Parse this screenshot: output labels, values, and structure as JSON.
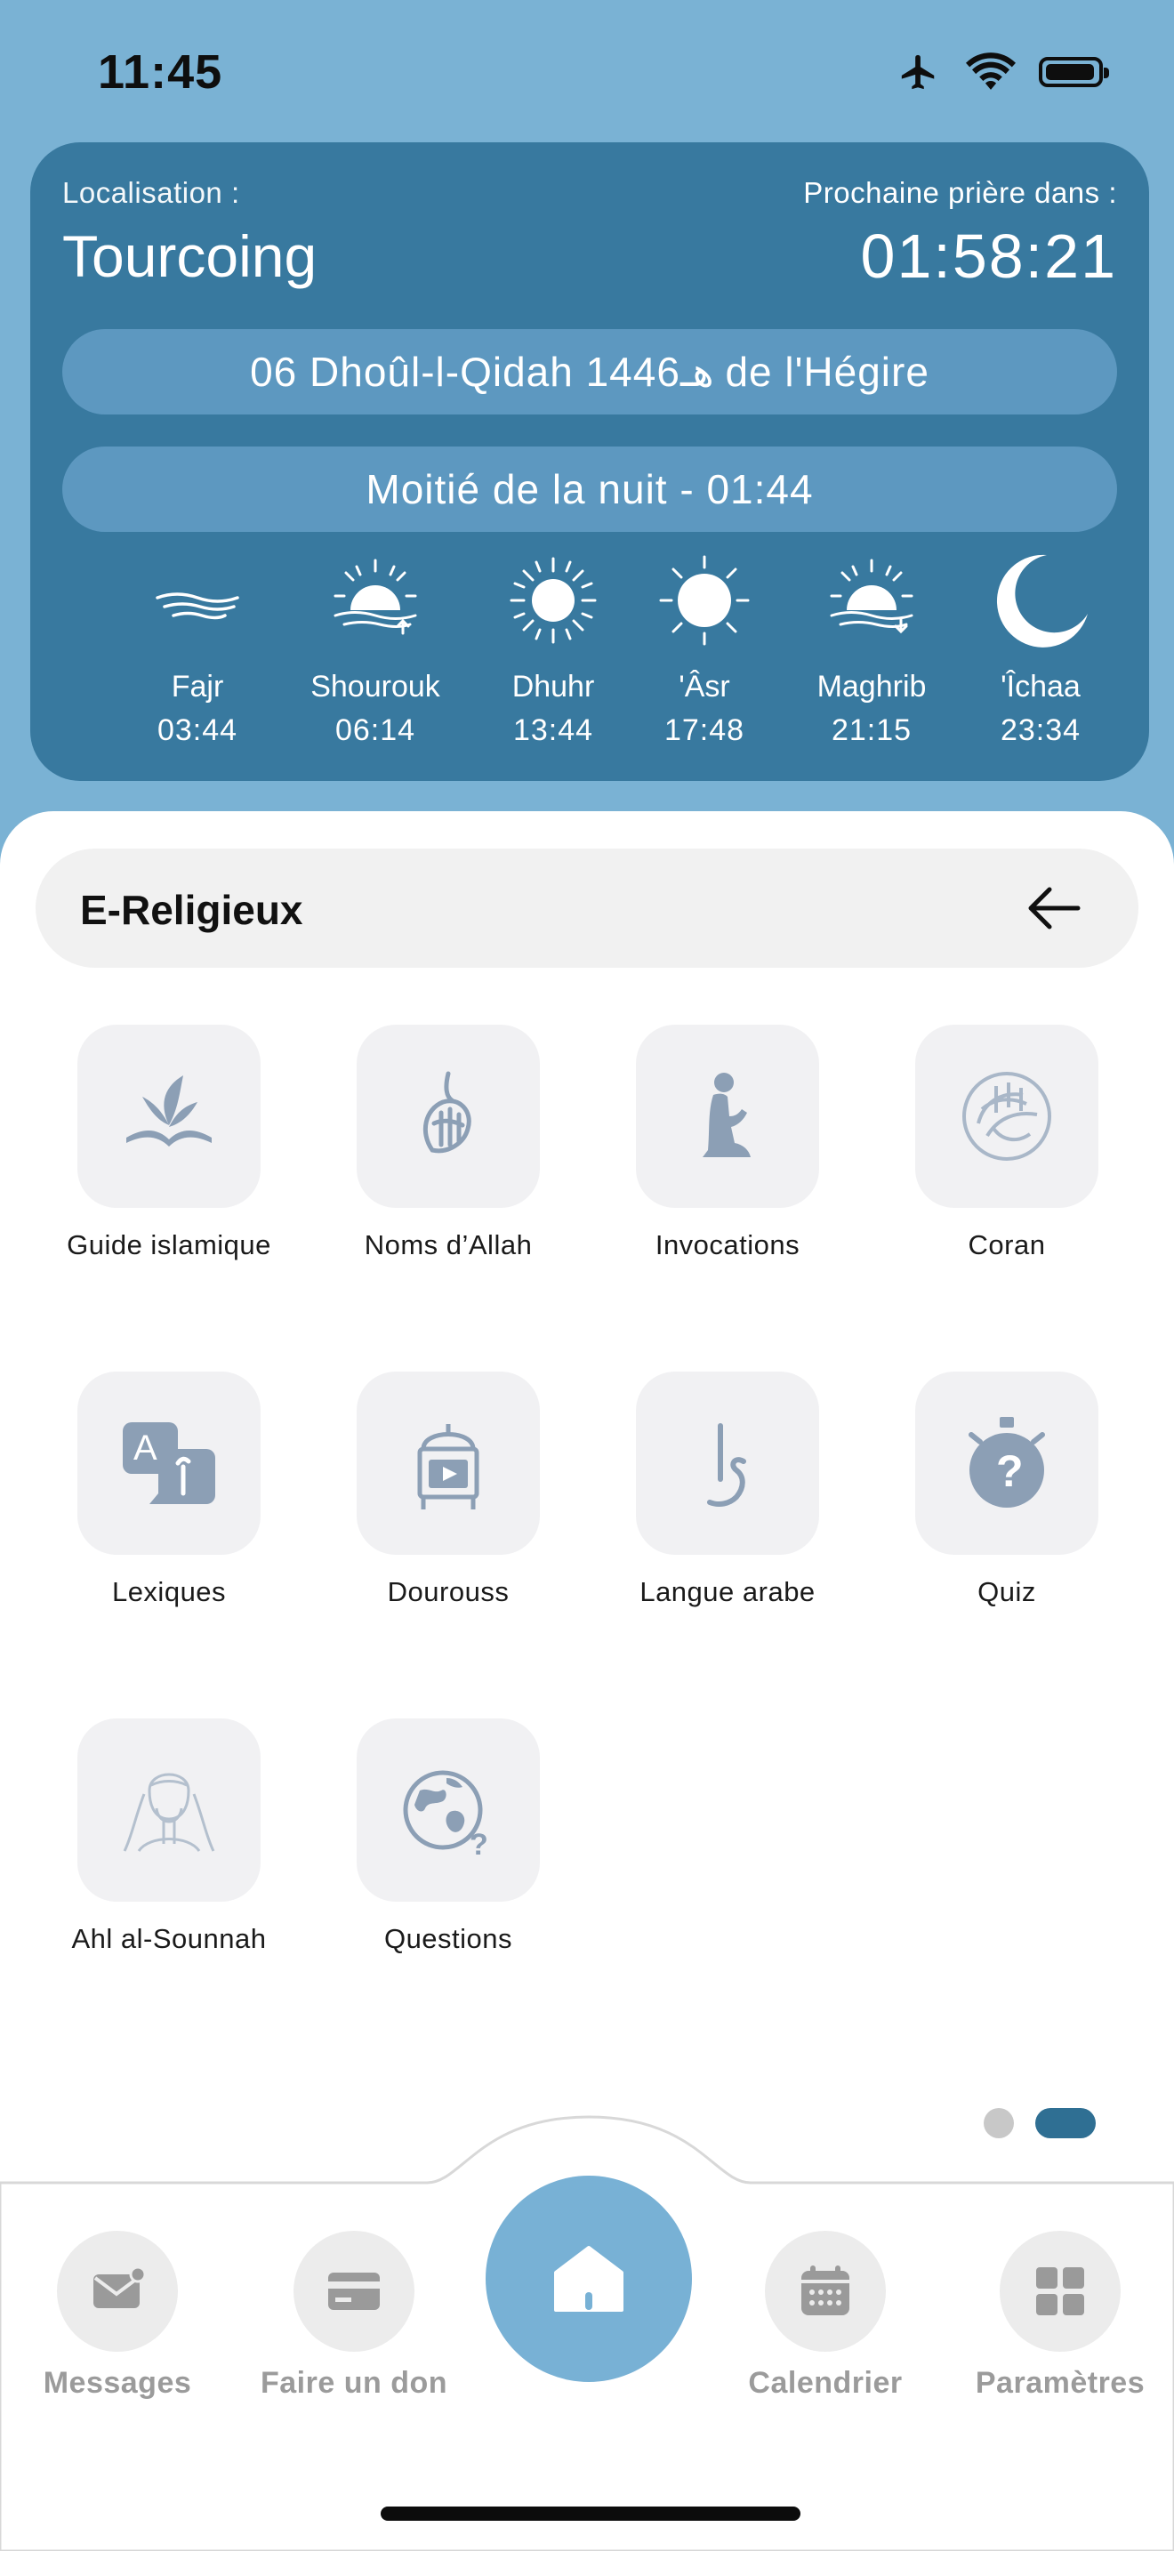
{
  "status_bar": {
    "time": "11:45",
    "icons": [
      "airplane-icon",
      "wifi-icon",
      "battery-icon"
    ]
  },
  "prayer_card": {
    "location_label": "Localisation :",
    "city": "Tourcoing",
    "next_prayer_label": "Prochaine prière dans :",
    "countdown": "01:58:21",
    "hijri_date": "06 Dhoûl-l-Qidah 1446هـ de l'Hégire",
    "midnight": "Moitié de la nuit - 01:44",
    "prayers": [
      {
        "name": "Fajr",
        "time": "03:44",
        "icon": "dawn-icon"
      },
      {
        "name": "Shourouk",
        "time": "06:14",
        "icon": "sunrise-icon"
      },
      {
        "name": "Dhuhr",
        "time": "13:44",
        "icon": "sun-icon"
      },
      {
        "name": "'Âsr",
        "time": "17:48",
        "icon": "sun-icon"
      },
      {
        "name": "Maghrib",
        "time": "21:15",
        "icon": "sunset-icon"
      },
      {
        "name": "'Îchaa",
        "time": "23:34",
        "icon": "moon-icon"
      }
    ]
  },
  "section": {
    "title": "E-Religieux",
    "items": [
      {
        "label": "Guide islamique",
        "icon": "book-icon"
      },
      {
        "label": "Noms d’Allah",
        "icon": "calligraphy-icon"
      },
      {
        "label": "Invocations",
        "icon": "praying-person-icon"
      },
      {
        "label": "Coran",
        "icon": "quran-seal-icon"
      },
      {
        "label": "Lexiques",
        "icon": "translate-icon"
      },
      {
        "label": "Dourouss",
        "icon": "lesson-video-icon"
      },
      {
        "label": "Langue arabe",
        "icon": "arabic-letter-icon"
      },
      {
        "label": "Quiz",
        "icon": "quiz-stopwatch-icon"
      },
      {
        "label": "Ahl al-Sounnah",
        "icon": "scholar-icon"
      },
      {
        "label": "Questions",
        "icon": "globe-question-icon"
      }
    ],
    "pages": {
      "count": 2,
      "active": 2
    }
  },
  "bottom_nav": {
    "items": [
      {
        "label": "Messages",
        "icon": "message-icon"
      },
      {
        "label": "Faire un don",
        "icon": "card-icon"
      },
      {
        "label": "",
        "icon": "home-icon"
      },
      {
        "label": "Calendrier",
        "icon": "calendar-icon"
      },
      {
        "label": "Paramètres",
        "icon": "grid-icon"
      }
    ]
  },
  "colors": {
    "card_blue": "#38799f",
    "pill_blue": "#5d98c0",
    "background_blue": "#7ab2d4",
    "active_dot": "#2f6f93",
    "icon_gray": "#8c9fb5"
  }
}
